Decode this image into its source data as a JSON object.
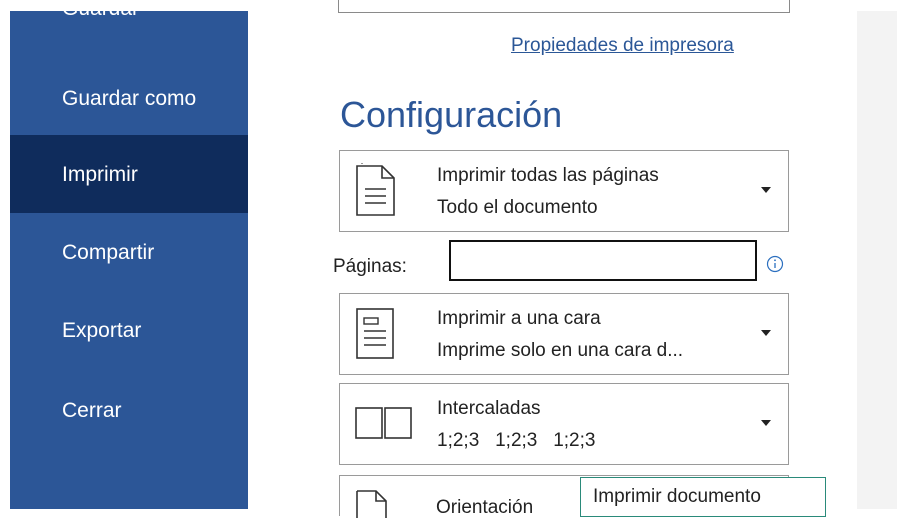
{
  "sidebar": {
    "items": [
      {
        "label": "Guardar",
        "active": false
      },
      {
        "label": "Guardar como",
        "active": false
      },
      {
        "label": "Imprimir",
        "active": true
      },
      {
        "label": "Compartir",
        "active": false
      },
      {
        "label": "Exportar",
        "active": false
      },
      {
        "label": "Cerrar",
        "active": false
      }
    ]
  },
  "printer": {
    "properties_link": "Propiedades de impresora"
  },
  "settings": {
    "title": "Configuración",
    "print_range": {
      "line1": "Imprimir todas las páginas",
      "line2": "Todo el documento"
    },
    "pages_label": "Páginas:",
    "pages_value": "",
    "sides": {
      "line1": "Imprimir a una cara",
      "line2": "Imprime solo en una cara d..."
    },
    "collation": {
      "line1": "Intercaladas",
      "line2": "1;2;3   1;2;3   1;2;3"
    },
    "orientation_partial": "Orientación"
  },
  "tooltip": {
    "text": "Imprimir documento"
  },
  "colors": {
    "sidebar": "#2c5697",
    "sidebar_active": "#0f2c5c",
    "link": "#2b5797",
    "title": "#2c5697"
  }
}
